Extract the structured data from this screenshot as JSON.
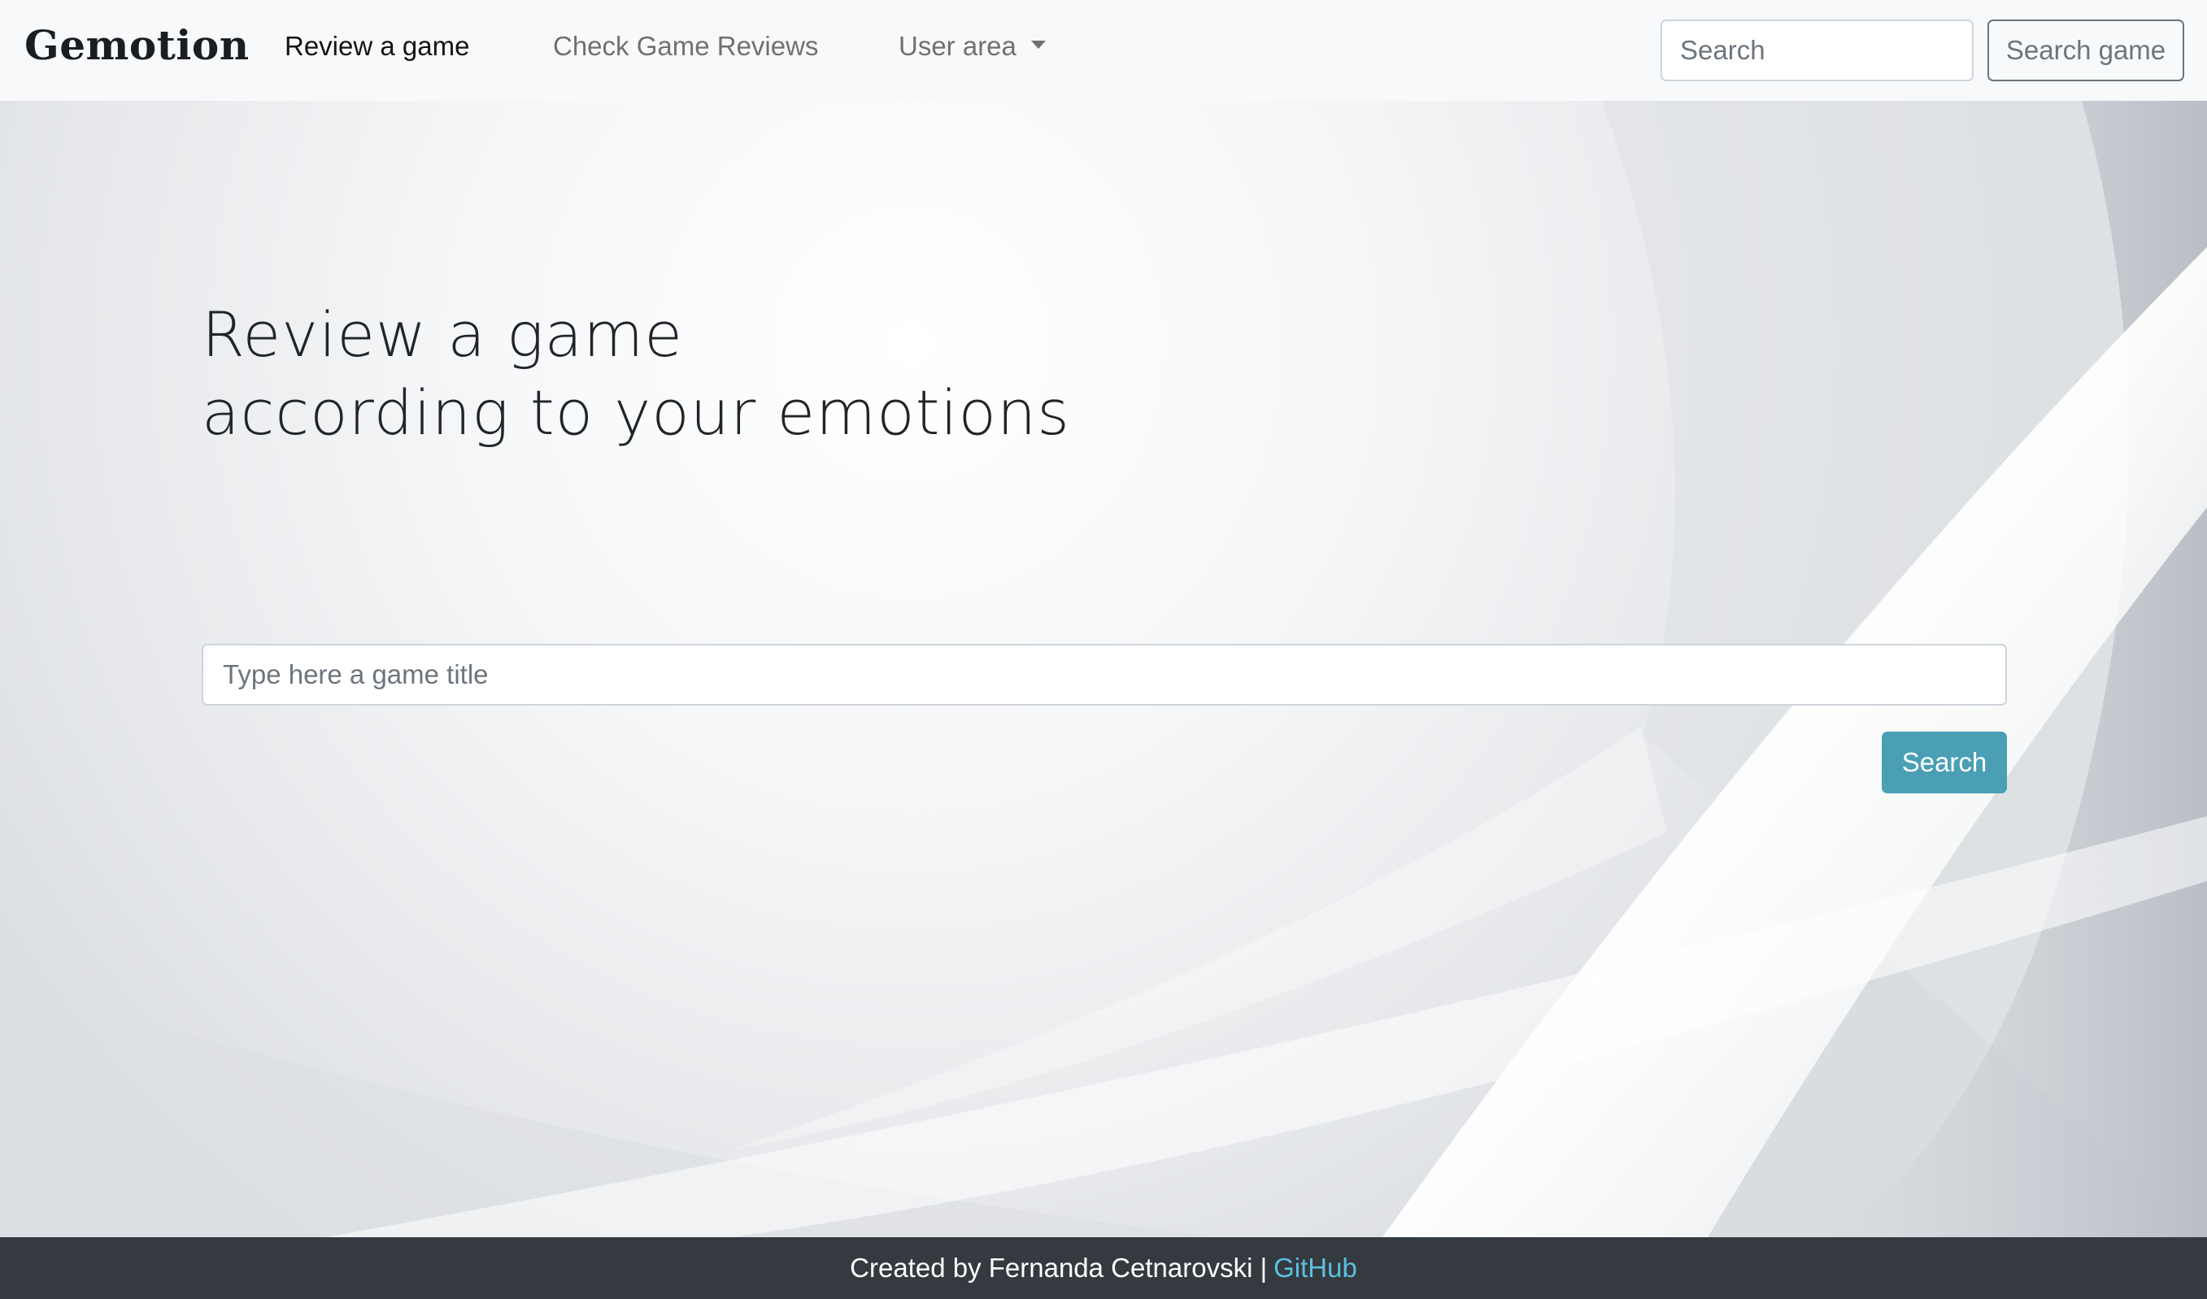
{
  "navbar": {
    "brand": "Gemotion",
    "links": [
      {
        "label": "Review a game"
      },
      {
        "label": "Check Game Reviews"
      },
      {
        "label": "User area"
      }
    ],
    "search": {
      "placeholder": "Search",
      "value": ""
    },
    "search_button": "Search game"
  },
  "hero": {
    "headline_line1": "Review a game",
    "headline_line2": "according to your emotions",
    "game_input": {
      "placeholder": "Type here a game title",
      "value": ""
    },
    "search_button": "Search"
  },
  "footer": {
    "credit": "Created by Fernanda Cetnarovski |",
    "link": "GitHub"
  },
  "colors": {
    "navbar_bg": "#f8f9fa",
    "footer_bg": "#343a40",
    "search_button": "#4a9fb5",
    "footer_link": "#5bc0de"
  }
}
